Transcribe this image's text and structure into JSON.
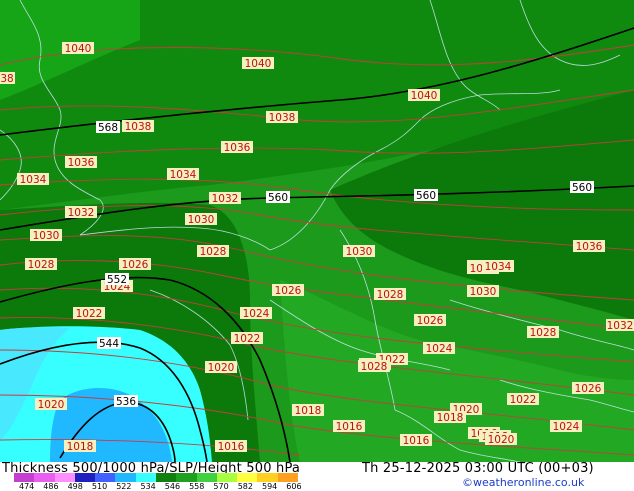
{
  "title": "Thickness 500/1000 hPa/SLP/Height 500 hPa",
  "datetime": "Th 25-12-2025 03:00 UTC (00+03)",
  "credit": "©weatheronline.co.uk",
  "legend": {
    "ticks": [
      "474",
      "486",
      "498",
      "510",
      "522",
      "534",
      "546",
      "558",
      "570",
      "582",
      "594",
      "606"
    ],
    "colors": [
      "#c43fd0",
      "#e85ff0",
      "#ff8fff",
      "#2020c0",
      "#4060ff",
      "#20b8ff",
      "#38ffff",
      "#108010",
      "#20a020",
      "#40d040",
      "#a8ff40",
      "#ffff40",
      "#ffd020",
      "#ffa020"
    ]
  },
  "isobar_labels": [
    "1040",
    "1040",
    "1040",
    "38",
    "1038",
    "1038",
    "1036",
    "1036",
    "1034",
    "1034",
    "1032",
    "1032",
    "1030",
    "1030",
    "1030",
    "1028",
    "1026",
    "1024",
    "1028",
    "1026",
    "1030",
    "1028",
    "1030",
    "1024",
    "1026",
    "1022",
    "1020",
    "1022",
    "1024",
    "1020",
    "1018",
    "1016",
    "1018",
    "1016",
    "1026",
    "1022",
    "1020",
    "1018",
    "1016",
    "1016",
    "1022",
    "1018",
    "1020",
    "1024",
    "1026",
    "1028",
    "1028",
    "1032",
    "1036",
    "1030",
    "1034"
  ],
  "height_labels": [
    "568",
    "560",
    "560",
    "560",
    "552",
    "544",
    "536"
  ],
  "colors": {
    "isobar_line": "#c83c3c",
    "height_line": "#000000",
    "coast_line": "#ffffff",
    "label_fill": "#f4f0c0",
    "label_text": "#c01010"
  }
}
